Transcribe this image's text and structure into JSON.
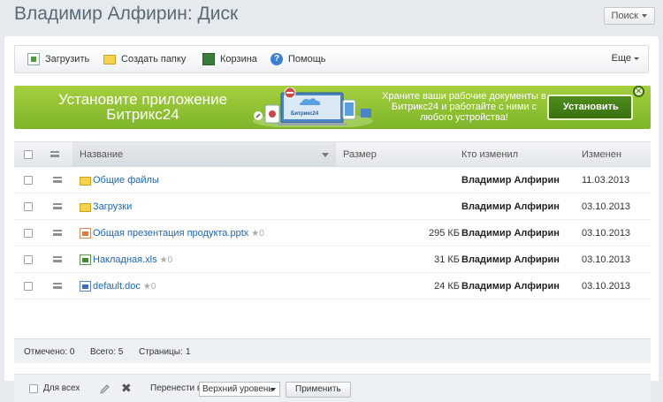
{
  "page_title": "Владимир Алфирин: Диск",
  "search_label": "Поиск",
  "toolbar": {
    "upload_label": "Загрузить",
    "new_folder_label": "Создать папку",
    "trash_label": "Корзина",
    "help_label": "Помощь",
    "more_label": "Еще"
  },
  "banner": {
    "title": "Установите приложение Битрикс24",
    "text": "Храните ваши рабочие документы в Битрикс24 и работайте с ними с любого устройства!",
    "app_label": "Битрикс24",
    "install_label": "Установить",
    "close_glyph": "✕"
  },
  "grid": {
    "headers": {
      "name": "Название",
      "size": "Размер",
      "modified_by": "Кто изменил",
      "modified": "Изменен"
    },
    "rows": [
      {
        "name": "Общие файлы",
        "icon": "shared-folder-icon",
        "size": "",
        "modified_by": "Владимир Алфирин",
        "modified": "11.03.2013",
        "likes": ""
      },
      {
        "name": "Загрузки",
        "icon": "folder-icon",
        "size": "",
        "modified_by": "Владимир Алфирин",
        "modified": "03.10.2013",
        "likes": ""
      },
      {
        "name": "Общая презентация продукта.pptx",
        "icon": "pptx-file-icon",
        "size": "295 КБ",
        "modified_by": "Владимир Алфирин",
        "modified": "03.10.2013",
        "likes": "★0"
      },
      {
        "name": "Накладная.xls",
        "icon": "xls-file-icon",
        "size": "31 КБ",
        "modified_by": "Владимир Алфирин",
        "modified": "03.10.2013",
        "likes": "★0"
      },
      {
        "name": "default.doc",
        "icon": "doc-file-icon",
        "size": "24 КБ",
        "modified_by": "Владимир Алфирин",
        "modified": "03.10.2013",
        "likes": "★0"
      }
    ]
  },
  "footer": {
    "selected": "Отмечено: 0",
    "total": "Всего: 5",
    "pages": "Страницы:",
    "page_num": "1"
  },
  "actions": {
    "for_all_label": "Для всех",
    "move_to_label": "Перенести в",
    "move_target": "Верхний уровень",
    "apply_label": "Применить"
  },
  "colors": {
    "banner_green": "#8fc235",
    "link_blue": "#2067b0",
    "page_bg": "#e6eaee"
  }
}
